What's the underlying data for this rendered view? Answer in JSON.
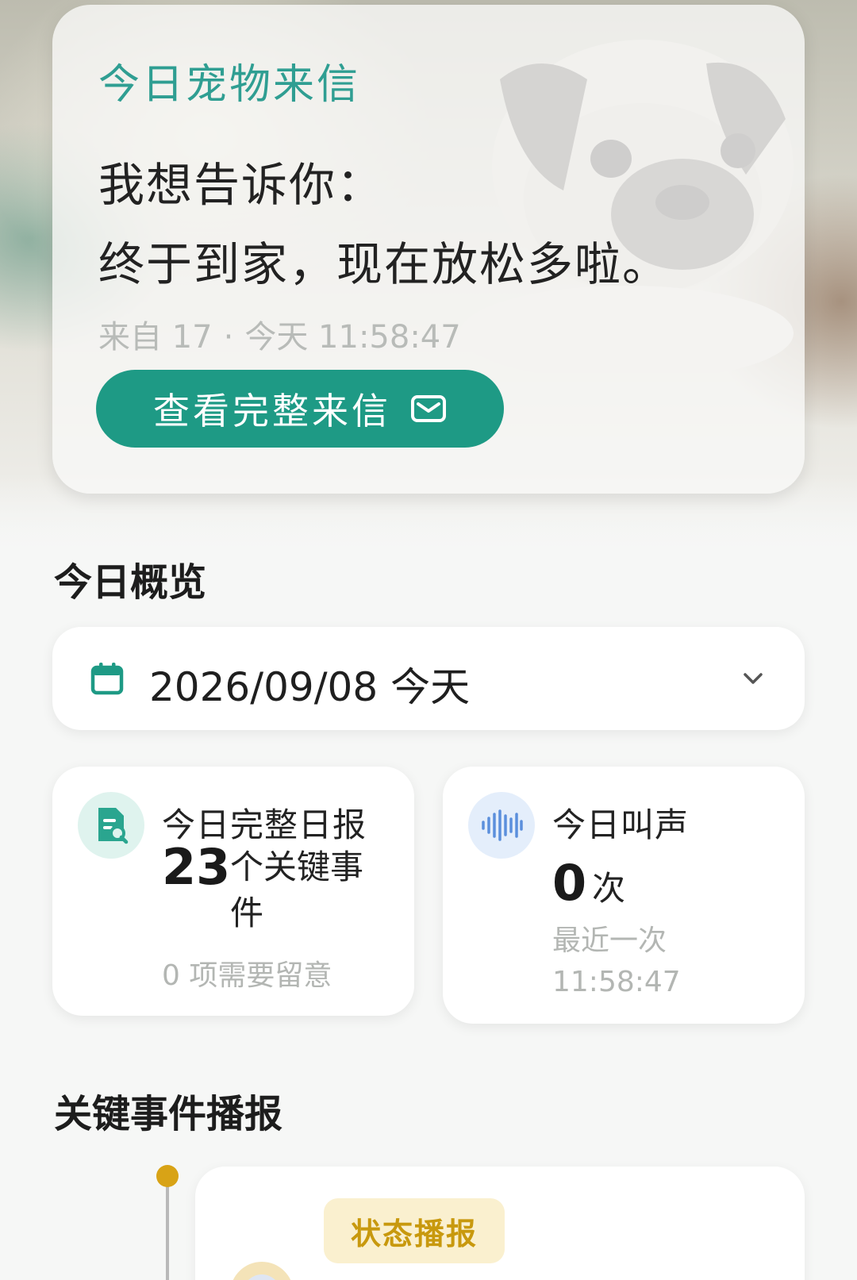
{
  "letter": {
    "title": "今日宠物来信",
    "line1": "我想告诉你：",
    "line2": "终于到家，现在放松多啦。",
    "from": "来自 17",
    "separator": "·",
    "time": "今天 11:58:47",
    "button_label": "查看完整来信",
    "button_icon": "mail-icon"
  },
  "overview": {
    "heading": "今日概览",
    "date": "2026/09/08 今天",
    "date_icon": "calendar-icon",
    "dropdown_icon": "chevron-down-icon"
  },
  "report_card": {
    "icon": "report-search-icon",
    "title": "今日完整日报",
    "count": "23",
    "unit": "个关键事件",
    "sub": "0 项需要留意"
  },
  "bark_card": {
    "icon": "sound-wave-icon",
    "title": "今日叫声",
    "count": "0",
    "unit": "次",
    "sub_label": "最近一次",
    "sub_time": "11:58:47"
  },
  "events": {
    "heading": "关键事件播报",
    "badge": "状态播报"
  },
  "colors": {
    "accent": "#1e9a85",
    "title_teal": "#2f9e92",
    "badge_bg": "#faf0cf",
    "badge_text": "#c8990e",
    "timeline_dot": "#d8a316"
  }
}
